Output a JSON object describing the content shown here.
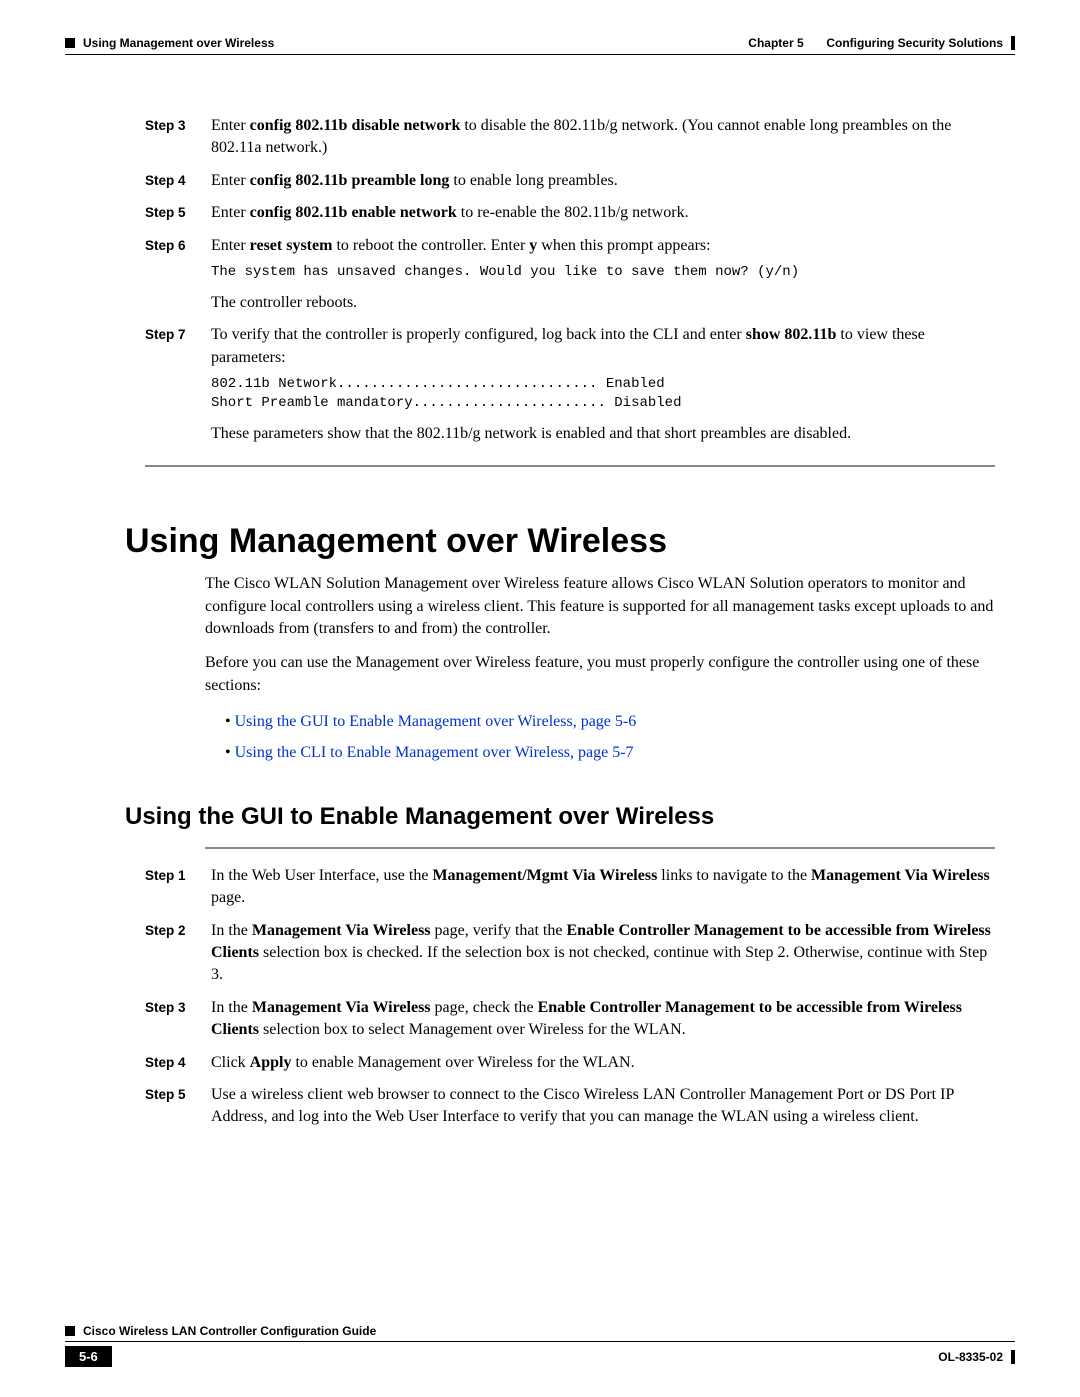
{
  "header": {
    "left": "Using Management over Wireless",
    "chapter": "Chapter 5",
    "chapter_title": "Configuring Security Solutions"
  },
  "stepsA": {
    "s3": {
      "label": "Step 3",
      "t1": "Enter ",
      "b1": "config 802.11b disable network",
      "t2": " to disable the 802.11b/g network. (You cannot enable long preambles on the 802.11a network.)"
    },
    "s4": {
      "label": "Step 4",
      "t1": "Enter ",
      "b1": "config 802.11b preamble long",
      "t2": " to enable long preambles."
    },
    "s5": {
      "label": "Step 5",
      "t1": "Enter ",
      "b1": "config 802.11b enable network",
      "t2": " to re-enable the 802.11b/g network."
    },
    "s6": {
      "label": "Step 6",
      "t1": "Enter ",
      "b1": "reset system",
      "t2": " to reboot the controller. Enter ",
      "b2": "y",
      "t3": " when this prompt appears:",
      "code": "The system has unsaved changes. Would you like to save them now? (y/n)",
      "after": "The controller reboots."
    },
    "s7": {
      "label": "Step 7",
      "t1": "To verify that the controller is properly configured, log back into the CLI and enter ",
      "b1": "show 802.11b",
      "t2": " to view these parameters:",
      "code": "802.11b Network............................... Enabled\nShort Preamble mandatory....................... Disabled",
      "after": "These parameters show that the 802.11b/g network is enabled and that short preambles are disabled."
    }
  },
  "h1": "Using Management over Wireless",
  "intro1": "The Cisco WLAN Solution Management over Wireless feature allows Cisco WLAN Solution operators to monitor and configure local controllers using a wireless client. This feature is supported for all management tasks except uploads to and downloads from (transfers to and from) the controller.",
  "intro2": "Before you can use the Management over Wireless feature, you must properly configure the controller using one of these sections:",
  "bullets": {
    "b1": "Using the GUI to Enable Management over Wireless, page 5-6",
    "b2": "Using the CLI to Enable Management over Wireless, page 5-7"
  },
  "h2": "Using the GUI to Enable Management over Wireless",
  "stepsB": {
    "s1": {
      "label": "Step 1",
      "t1": "In the Web User Interface, use the ",
      "b1": "Management/Mgmt Via Wireless",
      "t2": " links to navigate to the ",
      "b2": "Management Via Wireless",
      "t3": " page."
    },
    "s2": {
      "label": "Step 2",
      "t1": "In the ",
      "b1": "Management Via Wireless",
      "t2": " page, verify that the ",
      "b2": "Enable Controller Management to be accessible from Wireless Clients",
      "t3": " selection box is checked. If the selection box is not checked, continue with Step 2. Otherwise, continue with Step 3."
    },
    "s3": {
      "label": "Step 3",
      "t1": "In the ",
      "b1": "Management Via Wireless",
      "t2": " page, check the ",
      "b2": "Enable Controller Management to be accessible from Wireless Clients",
      "t3": " selection box to select Management over Wireless for the WLAN."
    },
    "s4": {
      "label": "Step 4",
      "t1": "Click ",
      "b1": "Apply",
      "t2": " to enable Management over Wireless for the WLAN."
    },
    "s5": {
      "label": "Step 5",
      "t1": "Use a wireless client web browser to connect to the Cisco Wireless LAN Controller Management Port or DS Port IP Address, and log into the Web User Interface to verify that you can manage the WLAN using a wireless client."
    }
  },
  "footer": {
    "guide": "Cisco Wireless LAN Controller Configuration Guide",
    "page": "5-6",
    "docid": "OL-8335-02"
  }
}
